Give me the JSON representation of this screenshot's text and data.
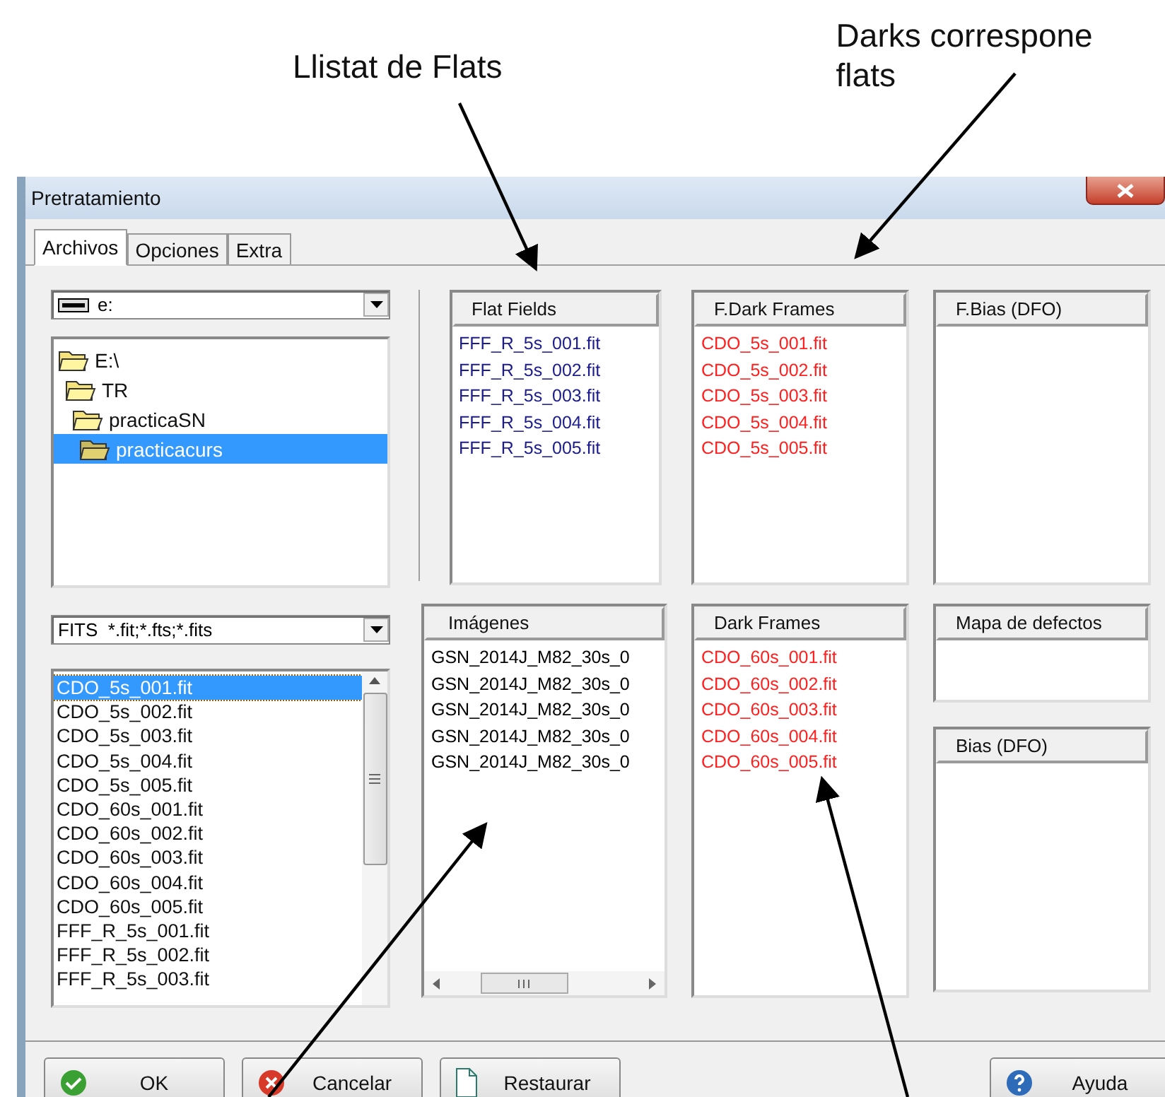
{
  "annotations": [
    {
      "lines": [
        "Llistat de Flats"
      ]
    },
    {
      "lines": [
        "Darks correspone",
        "flats"
      ]
    }
  ],
  "window": {
    "title": "Pretratamiento"
  },
  "tabs": [
    {
      "label": "Archivos",
      "selected": true
    },
    {
      "label": "Opciones",
      "selected": false
    },
    {
      "label": "Extra",
      "selected": false
    }
  ],
  "drive_select": {
    "value": "e:"
  },
  "folders": [
    {
      "name": "E:\\",
      "selected": false,
      "children": [
        {
          "name": "TR",
          "selected": false,
          "children": [
            {
              "name": "practicaSN",
              "selected": false,
              "children": [
                {
                  "name": "practicacurs",
                  "selected": true
                }
              ]
            }
          ]
        }
      ]
    }
  ],
  "filter_select": {
    "value": "FITS  *.fit;*.fts;*.fits"
  },
  "files": [
    {
      "name": "CDO_5s_001.fit",
      "selected": true
    },
    {
      "name": "CDO_5s_002.fit",
      "selected": false
    },
    {
      "name": "CDO_5s_003.fit",
      "selected": false
    },
    {
      "name": "CDO_5s_004.fit",
      "selected": false
    },
    {
      "name": "CDO_5s_005.fit",
      "selected": false
    },
    {
      "name": "CDO_60s_001.fit",
      "selected": false
    },
    {
      "name": "CDO_60s_002.fit",
      "selected": false
    },
    {
      "name": "CDO_60s_003.fit",
      "selected": false
    },
    {
      "name": "CDO_60s_004.fit",
      "selected": false
    },
    {
      "name": "CDO_60s_005.fit",
      "selected": false
    },
    {
      "name": "FFF_R_5s_001.fit",
      "selected": false
    },
    {
      "name": "FFF_R_5s_002.fit",
      "selected": false
    },
    {
      "name": "FFF_R_5s_003.fit",
      "selected": false
    }
  ],
  "panels_top": [
    {
      "title": "Flat Fields",
      "color": "#1c1c8c",
      "items": [
        "FFF_R_5s_001.fit",
        "FFF_R_5s_002.fit",
        "FFF_R_5s_003.fit",
        "FFF_R_5s_004.fit",
        "FFF_R_5s_005.fit"
      ]
    },
    {
      "title": "F.Dark Frames",
      "color": "#ff2020",
      "items": [
        "CDO_5s_001.fit",
        "CDO_5s_002.fit",
        "CDO_5s_003.fit",
        "CDO_5s_004.fit",
        "CDO_5s_005.fit"
      ]
    },
    {
      "title": "F.Bias (DFO)"
    }
  ],
  "panels_bottom": [
    {
      "title": "Imágenes",
      "color": "#000000",
      "items": [
        "GSN_2014J_M82_30s_0",
        "GSN_2014J_M82_30s_0",
        "GSN_2014J_M82_30s_0",
        "GSN_2014J_M82_30s_0",
        "GSN_2014J_M82_30s_0"
      ]
    },
    {
      "title": "Dark Frames",
      "color": "#ff2020",
      "items": [
        "CDO_60s_001.fit",
        "CDO_60s_002.fit",
        "CDO_60s_003.fit",
        "CDO_60s_004.fit",
        "CDO_60s_005.fit"
      ]
    },
    {
      "title": "Mapa de defectos"
    },
    {
      "title": "Bias (DFO)"
    }
  ],
  "buttons": [
    {
      "label": "OK",
      "kind": "ok"
    },
    {
      "label": "Cancelar",
      "kind": "cancel"
    },
    {
      "label": "Restaurar",
      "kind": "restore"
    },
    {
      "label": "Ayuda",
      "kind": "help"
    }
  ]
}
